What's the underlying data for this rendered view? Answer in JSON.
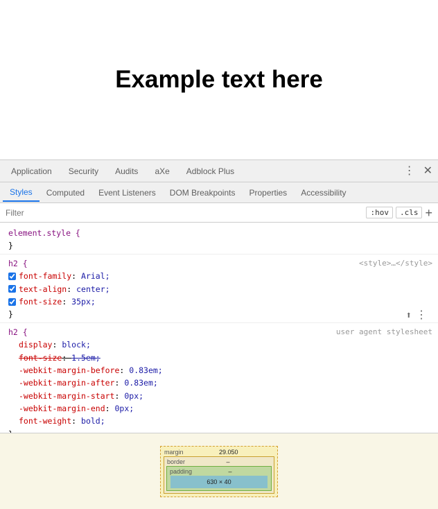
{
  "page": {
    "heading": "Example text here"
  },
  "devtools": {
    "top_tabs": [
      "Application",
      "Security",
      "Audits",
      "aXe",
      "Adblock Plus"
    ],
    "sub_tabs": [
      "Styles",
      "Computed",
      "Event Listeners",
      "DOM Breakpoints",
      "Properties",
      "Accessibility"
    ],
    "active_sub_tab": "Styles",
    "filter_placeholder": "Filter",
    "filter_hov": ":hov",
    "filter_cls": ".cls",
    "filter_add": "+",
    "css_blocks": [
      {
        "selector": "element.style {",
        "close": "}",
        "properties": [],
        "source": ""
      },
      {
        "selector": "h2 {",
        "close": "}",
        "properties": [
          {
            "name": "font-family",
            "value": "Arial;",
            "checked": true,
            "strikethrough": false
          },
          {
            "name": "text-align",
            "value": "center;",
            "checked": true,
            "strikethrough": false
          },
          {
            "name": "font-size",
            "value": "35px;",
            "checked": true,
            "strikethrough": false
          }
        ],
        "source": "<style>…</style>"
      },
      {
        "selector": "h2 {",
        "close": "}",
        "properties": [
          {
            "name": "display",
            "value": "block;",
            "checked": false,
            "strikethrough": false
          },
          {
            "name": "font-size",
            "value": "1.5em;",
            "checked": false,
            "strikethrough": true
          },
          {
            "name": "-webkit-margin-before",
            "value": "0.83em;",
            "checked": false,
            "strikethrough": false
          },
          {
            "name": "-webkit-margin-after",
            "value": "0.83em;",
            "checked": false,
            "strikethrough": false
          },
          {
            "name": "-webkit-margin-start",
            "value": "0px;",
            "checked": false,
            "strikethrough": false
          },
          {
            "name": "-webkit-margin-end",
            "value": "0px;",
            "checked": false,
            "strikethrough": false
          },
          {
            "name": "font-weight",
            "value": "bold;",
            "checked": false,
            "strikethrough": false
          }
        ],
        "source": "user agent stylesheet"
      }
    ],
    "box_model": {
      "margin_label": "margin",
      "margin_value": "29.050",
      "border_label": "border",
      "border_dash": "–",
      "padding_label": "padding",
      "padding_dash": "–",
      "content_label": "630 × 40",
      "side_values": [
        "–",
        "–"
      ]
    }
  }
}
